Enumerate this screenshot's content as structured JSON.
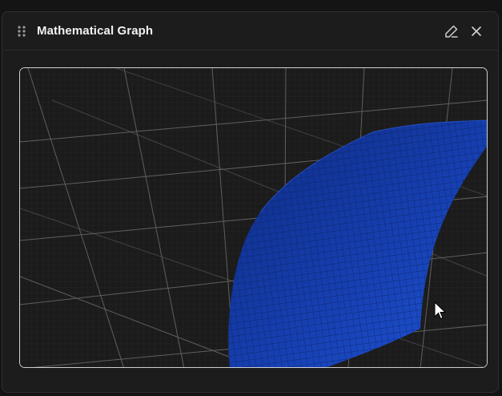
{
  "panel": {
    "title": "Mathematical Graph"
  },
  "icons": {
    "drag": "drag-handle-icon",
    "edit": "pencil-icon",
    "close": "close-icon",
    "cursor": "mouse-pointer-icon"
  },
  "colors": {
    "surface": "#1f4fd6",
    "surface_dark": "#0c2f8f",
    "grid": "#6a6a6a",
    "background": "#1b1b1b"
  }
}
